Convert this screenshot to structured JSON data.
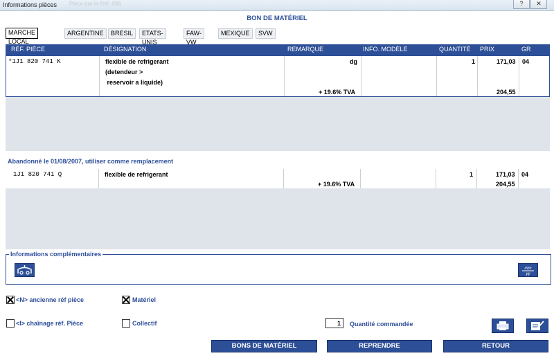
{
  "window": {
    "title": "Informations pièces",
    "ghost_text": "Pièce par la Réf. 098",
    "help_label": "?",
    "close_label": "✕"
  },
  "section_title": "BON DE MATÉRIEL",
  "tabs": [
    {
      "label": "MARCHE LOCAL",
      "active": true
    },
    {
      "label": "ARGENTINE",
      "active": false
    },
    {
      "label": "BRESIL",
      "active": false
    },
    {
      "label": "ETATS-UNIS",
      "active": false
    },
    {
      "label": "FAW-VW",
      "active": false
    },
    {
      "label": "MEXIQUE",
      "active": false
    },
    {
      "label": "SVW",
      "active": false
    }
  ],
  "grid": {
    "columns": [
      "RÉF. PIÈCE",
      "DÉSIGNATION",
      "REMARQUE",
      "INFO. MODÈLE",
      "QUANTITÉ",
      "PRIX",
      "GR"
    ],
    "row": {
      "ref": "*1J1 820 741 K",
      "designation_lines": [
        "flexible de refrigerant",
        "(detendeur >",
        " reservoir a liquide)"
      ],
      "remarque": "dg",
      "quantite": "1",
      "prix": "171,03",
      "gr": "04",
      "tva_label": "+ 19.6% TVA",
      "prix_ttc": "204,55"
    }
  },
  "replacement": {
    "notice": "Abandonné le 01/08/2007, utiliser comme remplacement",
    "row": {
      "ref": "1J1 820 741 Q",
      "designation": "flexible de refrigerant",
      "quantite": "1",
      "prix": "171,03",
      "gr": "04",
      "tva_label": "+ 19.6% TVA",
      "prix_ttc": "204,55"
    }
  },
  "info_group": {
    "legend": "Informations complémentaires",
    "left_icon": "vehicle-lift-icon",
    "right_icon": "calendar-date-icon",
    "right_icon_text_top": "mm",
    "right_icon_text_bottom": "yy"
  },
  "options": {
    "ancienne_ref": {
      "label": "<N> ancienne réf pièce",
      "checked": true
    },
    "chainage": {
      "label": "<I> chaînage réf. Pièce",
      "checked": false
    },
    "materiel": {
      "label": "Matériel",
      "checked": true
    },
    "collectif": {
      "label": "Collectif",
      "checked": false
    }
  },
  "quantity": {
    "value": "1",
    "label": "Quantité commandée"
  },
  "icons": {
    "print": "printer-icon",
    "edit": "edit-note-icon"
  },
  "buttons": {
    "bons": "BONS DE MATÉRIEL",
    "reprendre": "REPRENDRE",
    "retour": "RETOUR"
  },
  "colors": {
    "accent": "#2d4f97",
    "label_blue": "#2e4f9a",
    "panel_grey": "#dfe3ea"
  }
}
